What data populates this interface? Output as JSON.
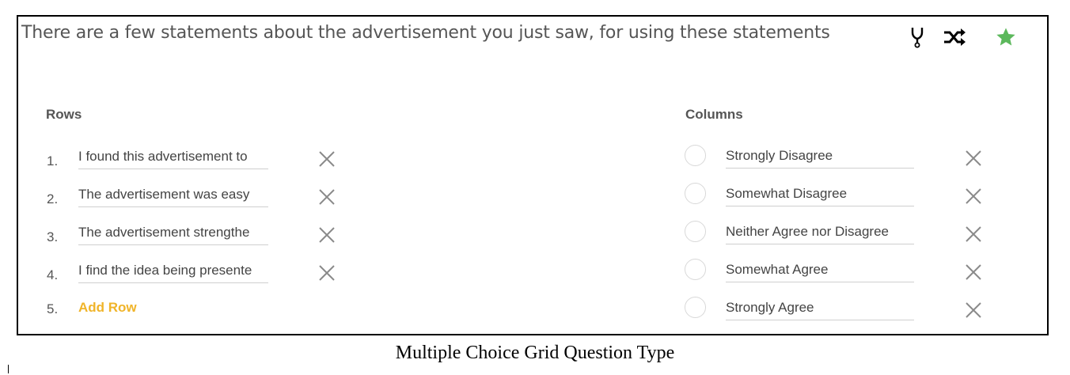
{
  "question": {
    "text": "There are a few statements about the advertisement you just saw, for using these statements"
  },
  "toolbar": {
    "icons": [
      "branch-icon",
      "shuffle-icon",
      "star-icon"
    ],
    "star_color": "#5cb85c"
  },
  "rows": {
    "heading": "Rows",
    "items": [
      {
        "num": "1.",
        "text": "I found this advertisement to"
      },
      {
        "num": "2.",
        "text": "The advertisement was easy"
      },
      {
        "num": "3.",
        "text": "The advertisement strengthe"
      },
      {
        "num": "4.",
        "text": "I find the idea being presente"
      }
    ],
    "add": {
      "num": "5.",
      "label": "Add Row"
    }
  },
  "columns": {
    "heading": "Columns",
    "items": [
      {
        "text": "Strongly Disagree"
      },
      {
        "text": "Somewhat Disagree"
      },
      {
        "text": "Neither Agree nor Disagree"
      },
      {
        "text": "Somewhat Agree"
      },
      {
        "text": "Strongly Agree"
      }
    ]
  },
  "accent_color": "#f0b429",
  "caption": "Multiple Choice Grid Question Type"
}
